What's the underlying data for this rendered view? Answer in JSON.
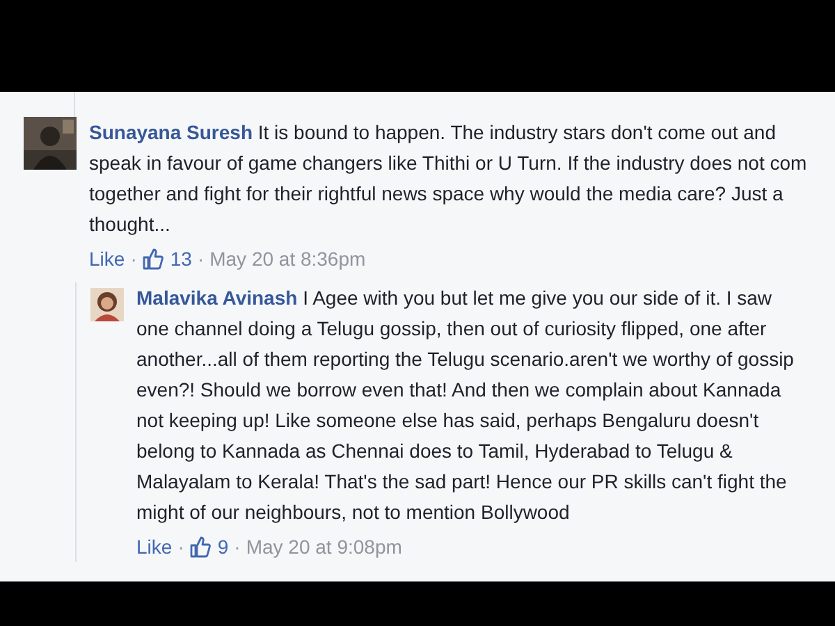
{
  "comments": [
    {
      "author": "Sunayana Suresh",
      "text": "It is bound to happen. The industry stars don't come out and speak in favour of game changers like Thithi or U Turn. If the industry does not com together and fight for their rightful news space why would the media care? Just a thought...",
      "like_label": "Like",
      "separator": "·",
      "likes": "13",
      "time": "May 20 at 8:36pm",
      "replies": [
        {
          "author": "Malavika Avinash",
          "text": "I Agee with you but let me give you our side of it. I saw one channel doing a Telugu gossip, then out of curiosity flipped, one after another...all of them reporting the Telugu scenario.aren't we worthy of gossip even?! Should we borrow even that! And then we complain about Kannada not keeping up! Like someone else has said, perhaps Bengaluru doesn't belong to Kannada as Chennai does to Tamil, Hyderabad to Telugu & Malayalam to Kerala! That's the sad part! Hence our PR skills can't fight the might of our neighbours, not to mention Bollywood",
          "like_label": "Like",
          "separator": "·",
          "likes": "9",
          "time": "May 20 at 9:08pm"
        }
      ]
    }
  ]
}
